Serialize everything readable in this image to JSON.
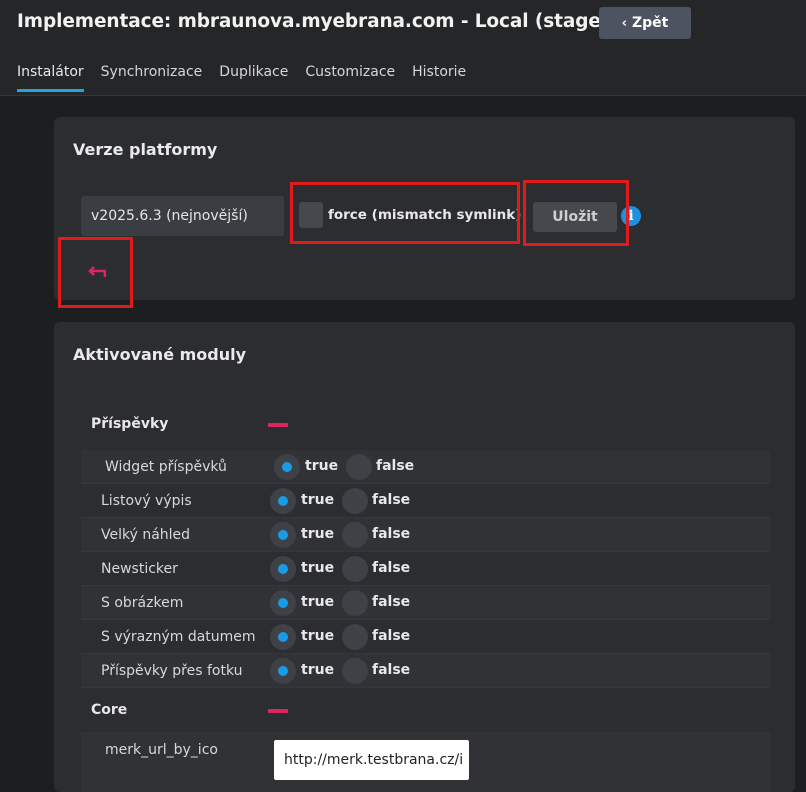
{
  "header": {
    "title": "Implementace: mbraunova.myebrana.com - Local (stage)",
    "back_label": "Zpět"
  },
  "tabs": [
    {
      "label": "Instalátor",
      "active": true
    },
    {
      "label": "Synchronizace",
      "active": false
    },
    {
      "label": "Duplikace",
      "active": false
    },
    {
      "label": "Customizace",
      "active": false
    },
    {
      "label": "Historie",
      "active": false
    }
  ],
  "platform": {
    "title": "Verze platformy",
    "version_value": "v2025.6.3 (nejnovější)",
    "force_label": "force (mismatch symlink)",
    "force_checked": false,
    "save_label": "Uložit",
    "info_icon": "info-circle-icon",
    "undo_icon": "undo-arrow-icon"
  },
  "modules": {
    "title": "Aktivované moduly",
    "groups": [
      {
        "label": "Příspěvky",
        "rows": [
          {
            "label": "Widget příspěvků",
            "value": true
          },
          {
            "label": "Listový výpis",
            "value": true
          },
          {
            "label": "Velký náhled",
            "value": true
          },
          {
            "label": "Newsticker",
            "value": true
          },
          {
            "label": "S obrázkem",
            "value": true
          },
          {
            "label": "S výrazným datumem",
            "value": true
          },
          {
            "label": "Příspěvky přes fotku",
            "value": true
          }
        ]
      },
      {
        "label": "Core",
        "fields": [
          {
            "key": "merk_url_by_ico",
            "value": "http://merk.testbrana.cz/i"
          }
        ]
      }
    ],
    "true_label": "true",
    "false_label": "false"
  },
  "colors": {
    "accent": "#1d9ae6",
    "highlight_box": "#e01b1b",
    "minus": "#e0245e"
  }
}
